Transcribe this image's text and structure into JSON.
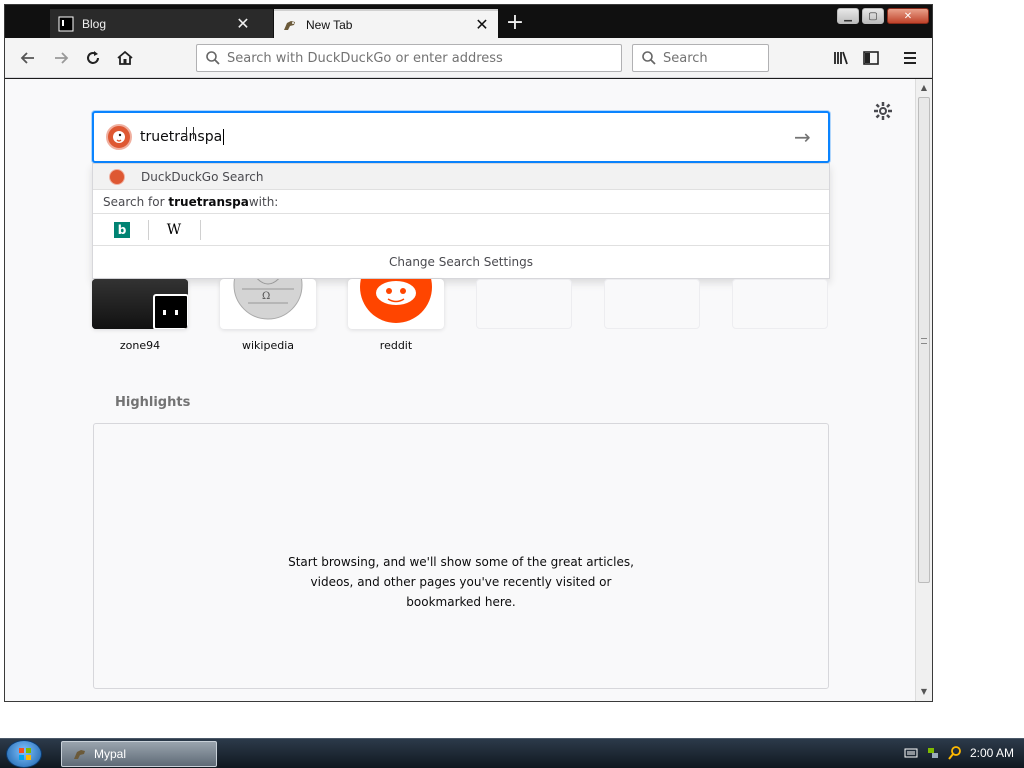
{
  "tabs": [
    {
      "title": "Blog",
      "favicon": "terminal-favicon"
    },
    {
      "title": "New Tab",
      "favicon": "horse-favicon"
    }
  ],
  "toolbar": {
    "url_placeholder": "Search with DuckDuckGo or enter address",
    "search_placeholder": "Search"
  },
  "newtab": {
    "search_value": "truetranspa",
    "suggestion_label": "DuckDuckGo Search",
    "search_for_prefix": "Search for ",
    "search_for_term": "truetranspa",
    "search_for_suffix": " with:",
    "engines": [
      "bing",
      "W"
    ],
    "change_settings": "Change Search Settings",
    "top_sites": [
      {
        "label": "zone94"
      },
      {
        "label": "wikipedia"
      },
      {
        "label": "reddit"
      },
      {
        "label": ""
      },
      {
        "label": ""
      },
      {
        "label": ""
      }
    ],
    "highlights_title": "Highlights",
    "highlights_line1": "Start browsing, and we'll show some of the great articles,",
    "highlights_line2": "videos, and other pages you've recently visited or",
    "highlights_line3": "bookmarked here."
  },
  "taskbar": {
    "app_label": "Mypal",
    "clock": "2:00 AM"
  },
  "colors": {
    "accent": "#0a84ff",
    "ddg": "#de5833",
    "reddit": "#ff4500",
    "bing": "#008373"
  }
}
